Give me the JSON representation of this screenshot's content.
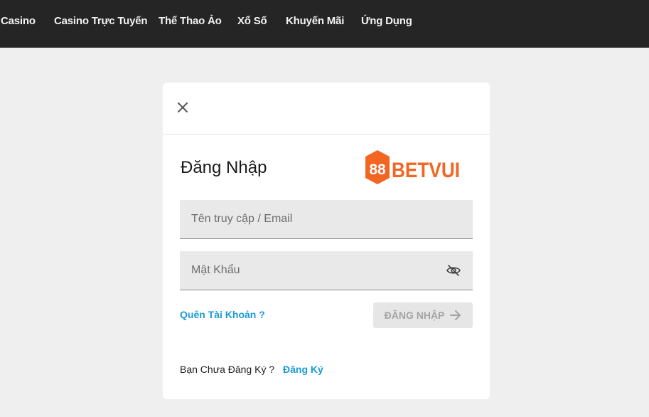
{
  "nav": {
    "items": [
      {
        "label": "Casino"
      },
      {
        "label": "Casino Trực Tuyến"
      },
      {
        "label": "Thể Thao Ảo"
      },
      {
        "label": "Xổ Số"
      },
      {
        "label": "Khuyến Mãi"
      },
      {
        "label": "Ứng Dụng"
      }
    ]
  },
  "modal": {
    "title": "Đăng Nhập",
    "close_icon": "close-icon",
    "logo": {
      "text": "88BETVUI",
      "brand_color": "#f26522"
    },
    "username": {
      "placeholder": "Tên truy cập / Email",
      "value": ""
    },
    "password": {
      "placeholder": "Mật Khẩu",
      "value": "",
      "toggle_icon": "eye-slash-icon"
    },
    "forgot_label": "Quên Tài Khoản ?",
    "login_label": "ĐĂNG NHẬP",
    "login_icon": "arrow-right-icon",
    "signup_prompt": "Bạn Chưa Đăng Ký ?",
    "signup_label": "Đăng Ký"
  },
  "colors": {
    "nav_bg": "#252525",
    "page_bg": "#efefef",
    "link": "#1a9bd7",
    "brand": "#f26522"
  }
}
